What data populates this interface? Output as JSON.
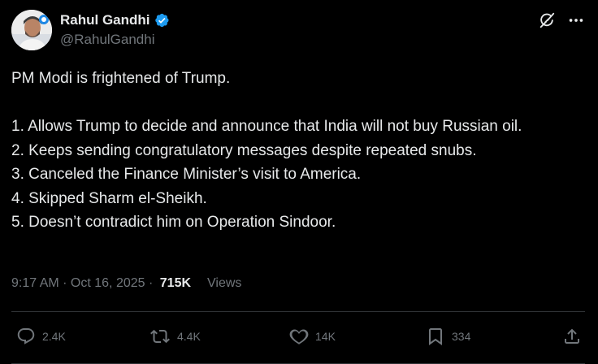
{
  "author": {
    "display_name": "Rahul Gandhi",
    "handle": "@RahulGandhi"
  },
  "post": {
    "lines": [
      "PM Modi is frightened of Trump.",
      "1. Allows Trump to decide and announce that India will not buy Russian oil.",
      "2. Keeps sending congratulatory messages despite repeated snubs.",
      "3. Canceled the Finance Minister’s visit to America.",
      "4. Skipped Sharm el-Sheikh.",
      "5. Doesn’t contradict him on Operation Sindoor."
    ]
  },
  "meta": {
    "time": "9:17 AM",
    "separator1": " · ",
    "date": "Oct 16, 2025",
    "separator2": " · ",
    "views_count": "715K",
    "views_label": "Views"
  },
  "actions": {
    "replies": "2.4K",
    "reposts": "4.4K",
    "likes": "14K",
    "bookmarks": "334"
  },
  "icons": {
    "verified": "verified-badge-icon",
    "grok": "grok-icon",
    "more": "more-icon",
    "reply": "reply-icon",
    "repost": "repost-icon",
    "like": "heart-icon",
    "bookmark": "bookmark-icon",
    "share": "share-icon"
  },
  "colors": {
    "background": "#000000",
    "text": "#e7e9ea",
    "secondary": "#71767b",
    "verified": "#1d9bf0",
    "border": "#2f3336"
  }
}
